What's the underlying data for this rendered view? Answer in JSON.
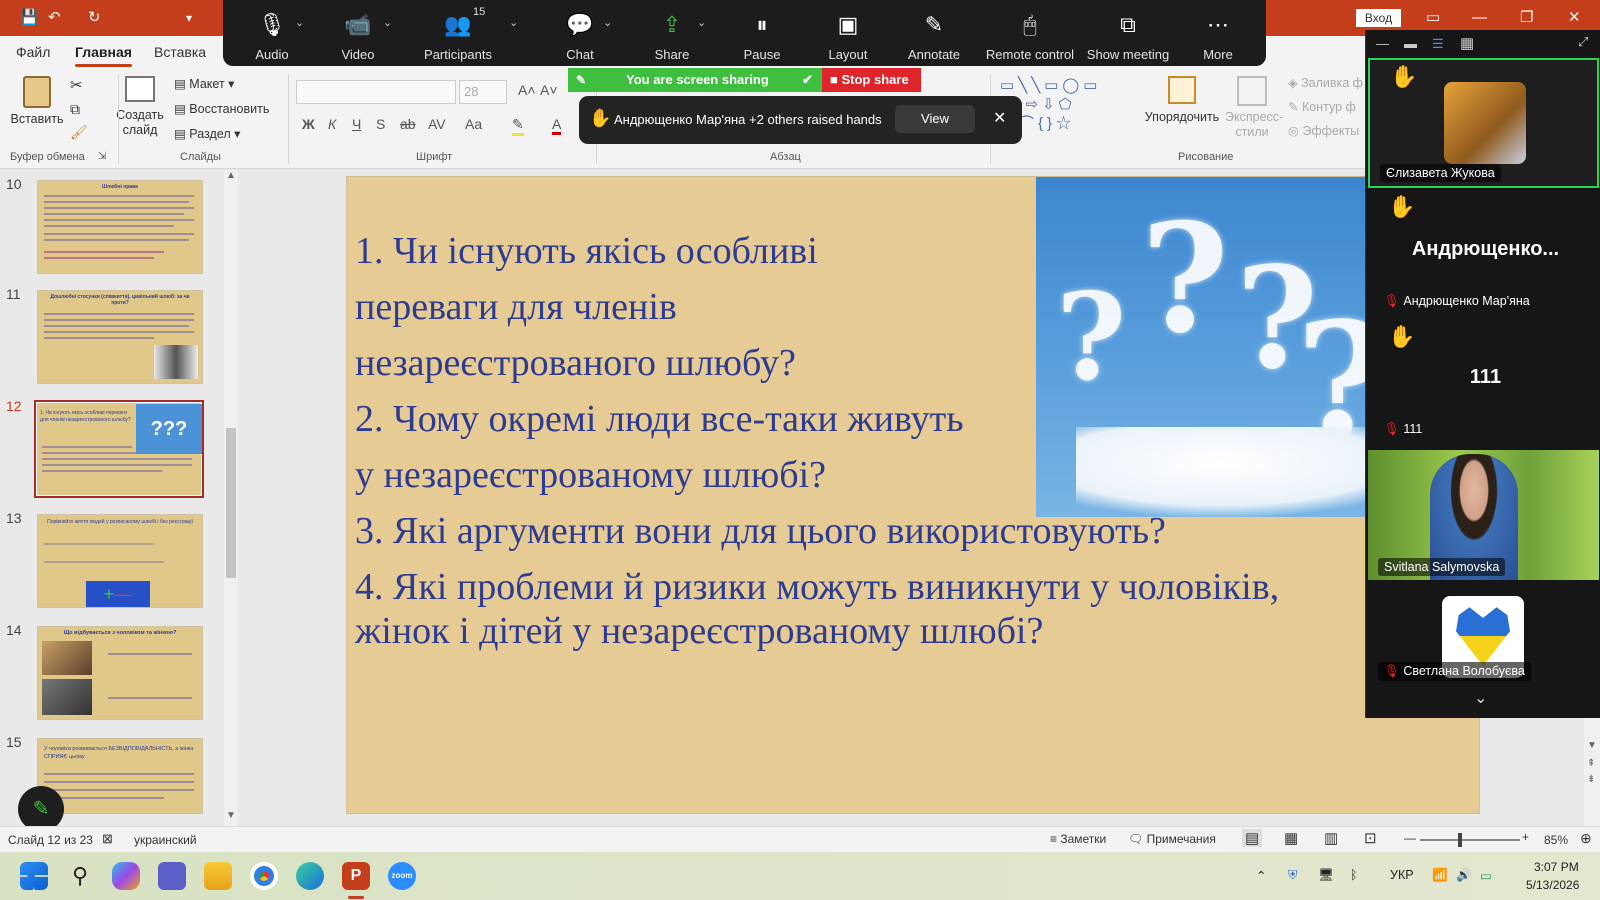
{
  "app": {
    "quick_access": {
      "save": "💾",
      "undo": "↶",
      "redo": "↻",
      "more": "▾"
    },
    "window": {
      "signin_label": "Вход",
      "minimize": "—",
      "restore": "❐",
      "close": "✕"
    }
  },
  "menu": {
    "tabs": [
      {
        "label": "Файл"
      },
      {
        "label": "Главная"
      },
      {
        "label": "Вставка"
      }
    ]
  },
  "ribbon": {
    "paste_label": "Вставить",
    "create_slide_label": "Создать слайд",
    "layout_label": "Макет",
    "reset_label": "Восстановить",
    "section_label": "Раздел",
    "font_size": "28",
    "arrange_label": "Упорядочить",
    "quick_styles_label": "Экспресс-стили",
    "fill_label": "Заливка ф",
    "outline_label": "Контур ф",
    "effects_label": "Эффекты",
    "groups": {
      "clipboard": "Буфер обмена",
      "slides": "Слайды",
      "font": "Шрифт",
      "paragraph": "Абзац",
      "drawing": "Рисование"
    }
  },
  "zoom": {
    "buttons": [
      {
        "label": "Audio",
        "icon": "🎙"
      },
      {
        "label": "Video",
        "icon": "📹"
      },
      {
        "label": "Participants",
        "icon": "👥",
        "badge": "15"
      },
      {
        "label": "Chat",
        "icon": "💬"
      },
      {
        "label": "Share",
        "icon": "⇪"
      },
      {
        "label": "Pause",
        "icon": "⏸"
      },
      {
        "label": "Layout",
        "icon": "▣"
      },
      {
        "label": "Annotate",
        "icon": "✎"
      },
      {
        "label": "Remote control",
        "icon": "🖱"
      },
      {
        "label": "Show meeting",
        "icon": "⧉"
      },
      {
        "label": "More",
        "icon": "⋯"
      }
    ],
    "sharing_text": "You are screen sharing",
    "stop_share_label": "Stop share",
    "notification": {
      "text": "Андрющенко Мар'яна +2 others raised hands",
      "view_label": "View"
    }
  },
  "thumbnails": {
    "items": [
      {
        "number": "10",
        "title": "Шлюбні права"
      },
      {
        "number": "11",
        "title": "Дошлюбні стосунки (співжиття), цивільний шлюб: за чи проти?"
      },
      {
        "number": "12",
        "title": "1. Чи існують якісь особливі переваги для членів незареєстрованого шлюбу?"
      },
      {
        "number": "13",
        "title": "Порівняйте життя людей у розписаному шлюбі і без реєстрації"
      },
      {
        "number": "14",
        "title": "Що відбувається з чоловіком та жінкою?"
      },
      {
        "number": "15",
        "title": "У чоловіка розвивається БЕЗВІДПОВІДАЛЬНІСТЬ, а жінка СПРИЯЄ цьому"
      }
    ]
  },
  "slide": {
    "lines": [
      "1. Чи існують якісь особливі",
      "переваги для членів",
      "незареєстрованого шлюбу?",
      "2. Чому окремі люди все-таки живуть",
      "у незареєстрованому шлюбі?",
      "3. Які аргументи вони для цього використовують?",
      "4.  Які  проблеми  й  ризики  можуть  виникнути  у  чоловіків,",
      "жінок і дітей у незареєстрованому шлюбі?"
    ]
  },
  "gallery": {
    "participants": [
      {
        "name": "Єлизавета Жукова"
      },
      {
        "display": "Андрющенко...",
        "name": "Андрющенко Мар'яна"
      },
      {
        "display": "111",
        "name": "111"
      },
      {
        "name": "Svitlana Salymovska"
      },
      {
        "name": "Светлана Волобуєва"
      }
    ]
  },
  "status": {
    "slide_counter": "Слайд 12 из 23",
    "language": "украинский",
    "notes_label": "Заметки",
    "comments_label": "Примечания",
    "zoom_level": "85%"
  },
  "taskbar": {
    "lang": "УКР",
    "time": "3:07 PM",
    "date": "5/13/2026"
  },
  "colors": {
    "accent": "#c43e1c",
    "slide_text": "#2d3c91",
    "share_green": "#3fbf3f",
    "stop_red": "#e0242b"
  }
}
